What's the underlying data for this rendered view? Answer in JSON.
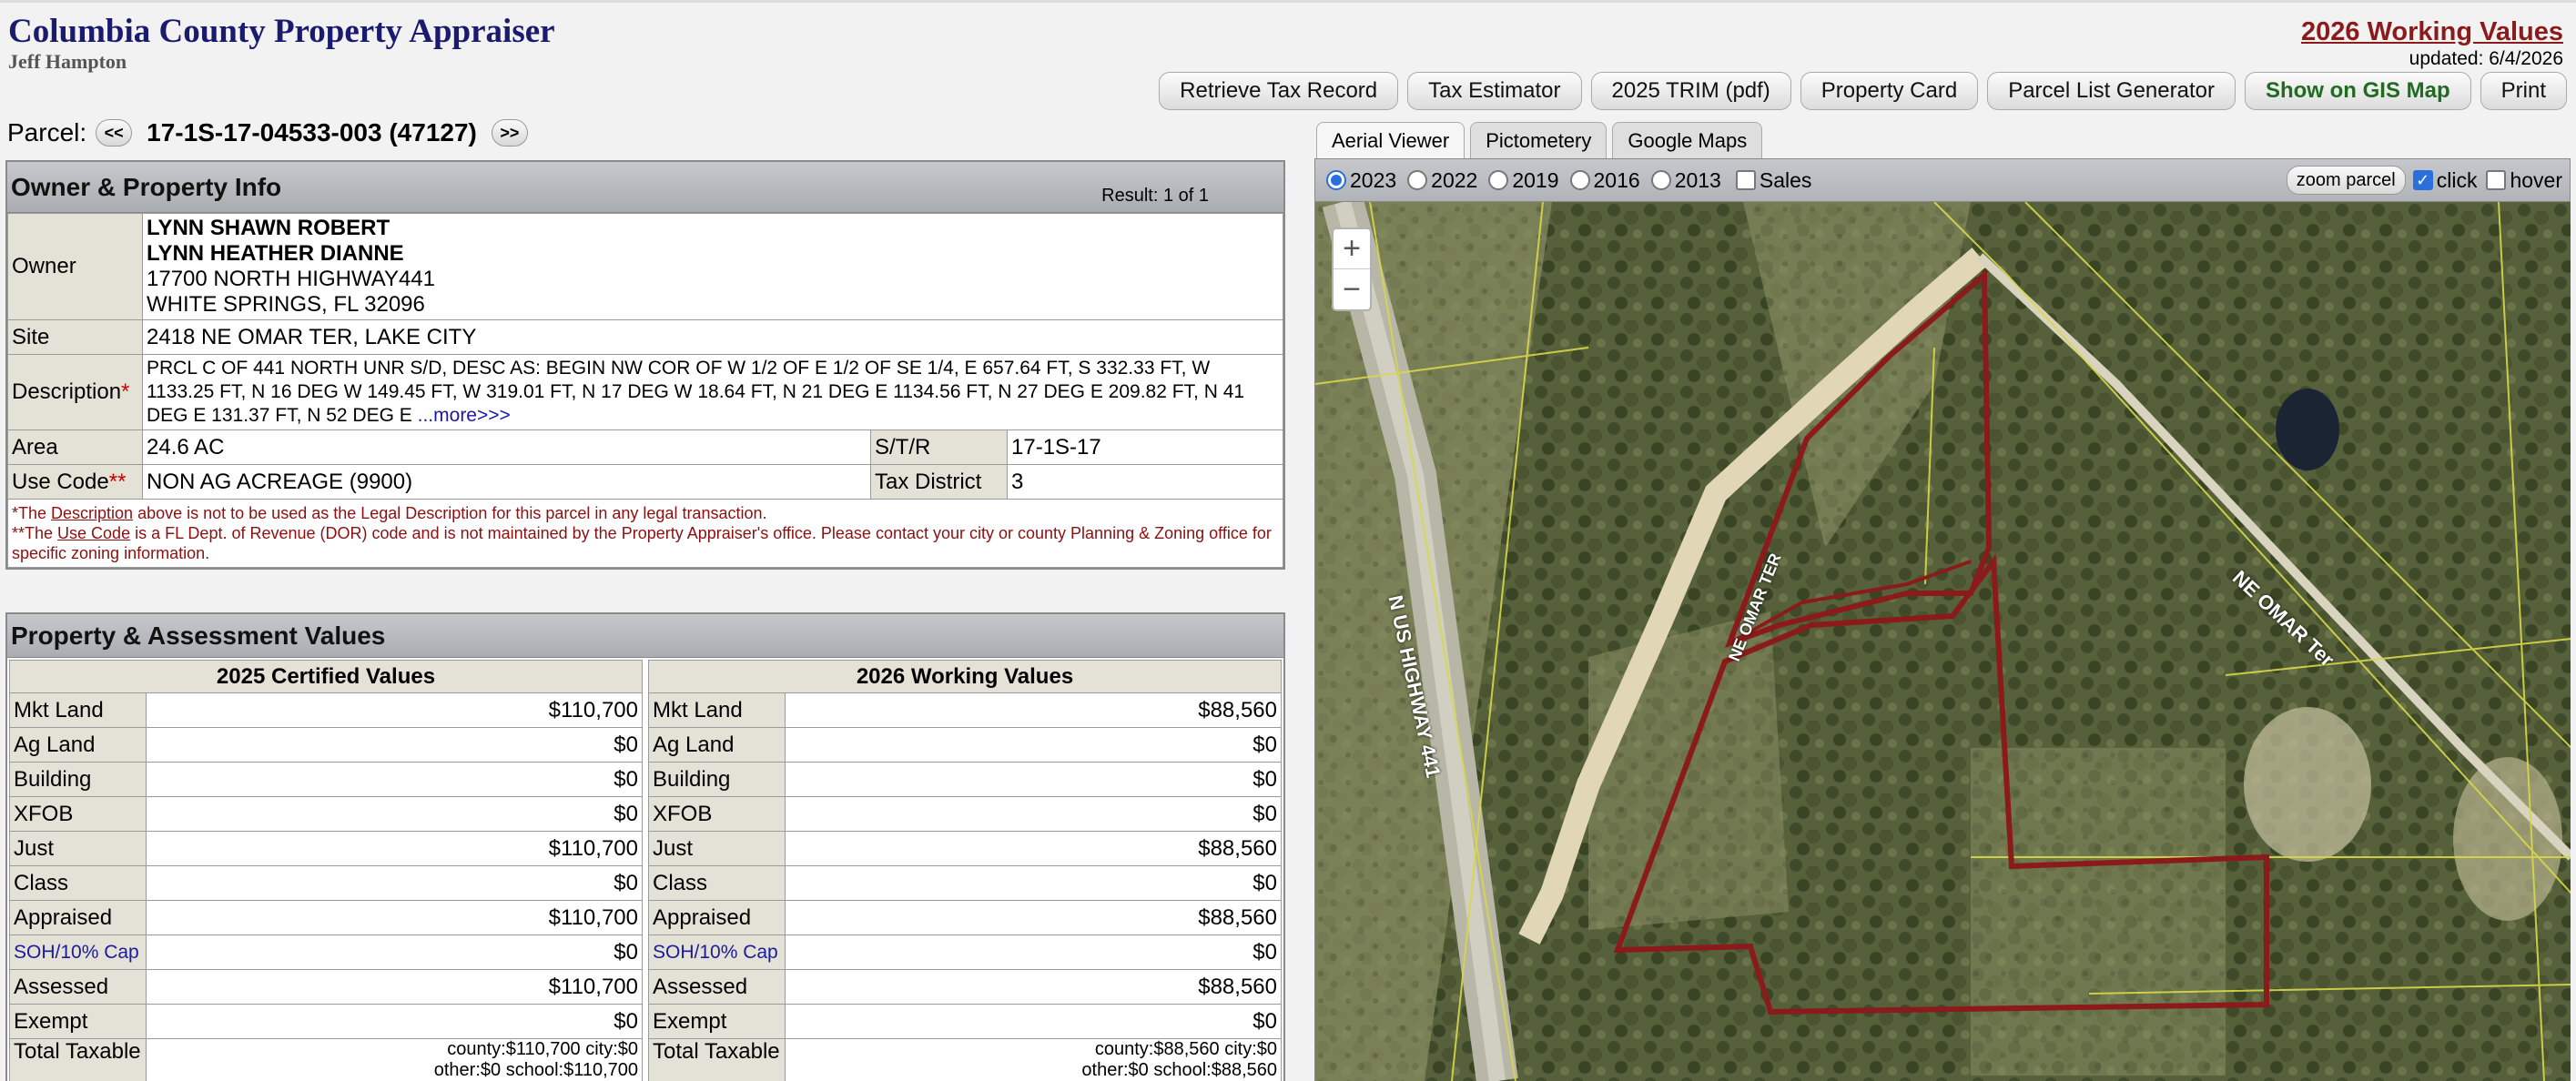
{
  "header": {
    "title": "Columbia County Property Appraiser",
    "subtitle": "Jeff Hampton",
    "working_values_link": "2026 Working Values",
    "updated": "updated: 6/4/2026"
  },
  "toolbar": {
    "retrieve": "Retrieve Tax Record",
    "estimator": "Tax Estimator",
    "trim": "2025 TRIM (pdf)",
    "card": "Property Card",
    "list": "Parcel List Generator",
    "gis": "Show on GIS Map",
    "print": "Print"
  },
  "parcel": {
    "label": "Parcel:",
    "prev": "<<",
    "id": "17-1S-17-04533-003 (47127)",
    "next": ">>"
  },
  "owner_panel": {
    "title": "Owner & Property Info",
    "result": "Result: 1 of 1",
    "owner_label": "Owner",
    "owner_lines": [
      "LYNN SHAWN ROBERT",
      "LYNN HEATHER DIANNE",
      "17700 NORTH HIGHWAY441",
      "WHITE SPRINGS, FL 32096"
    ],
    "site_label": "Site",
    "site": "2418 NE OMAR TER, LAKE CITY",
    "desc_label": "Description",
    "desc_mark": "*",
    "description": "PRCL C OF 441 NORTH UNR S/D, DESC AS: BEGIN NW COR OF W 1/2 OF E 1/2 OF SE 1/4, E 657.64 FT, S 332.33 FT, W 1133.25 FT, N 16 DEG W 149.45 FT, W 319.01 FT, N 17 DEG W 18.64 FT, N 21 DEG E 1134.56 FT, N 27 DEG E 209.82 FT, N 41 DEG E 131.37 FT, N 52 DEG E",
    "more": "...more>>>",
    "area_label": "Area",
    "area": "24.6 AC",
    "str_label": "S/T/R",
    "str": "17-1S-17",
    "use_label": "Use Code",
    "use_mark": "**",
    "use_code": "NON AG ACREAGE (9900)",
    "tax_label": "Tax District",
    "tax_district": "3",
    "note1_pre": "*The ",
    "note1_link": "Description",
    "note1_post": " above is not to be used as the Legal Description for this parcel in any legal transaction.",
    "note2_pre": "**The ",
    "note2_link": "Use Code",
    "note2_post": " is a FL Dept. of Revenue (DOR) code and is not maintained by the Property Appraiser's office. Please contact your city or county Planning & Zoning office for specific zoning information."
  },
  "values_panel": {
    "title": "Property & Assessment Values",
    "certified_header": "2025 Certified Values",
    "working_header": "2026 Working Values",
    "certified_rows": [
      {
        "label": "Mkt Land",
        "value": "$110,700"
      },
      {
        "label": "Ag Land",
        "value": "$0"
      },
      {
        "label": "Building",
        "value": "$0"
      },
      {
        "label": "XFOB",
        "value": "$0"
      },
      {
        "label": "Just",
        "value": "$110,700"
      },
      {
        "label": "Class",
        "value": "$0"
      },
      {
        "label": "Appraised",
        "value": "$110,700"
      },
      {
        "label": "SOH/10% Cap",
        "value": "$0"
      },
      {
        "label": "Assessed",
        "value": "$110,700"
      },
      {
        "label": "Exempt",
        "value": "$0"
      }
    ],
    "working_rows": [
      {
        "label": "Mkt Land",
        "value": "$88,560"
      },
      {
        "label": "Ag Land",
        "value": "$0"
      },
      {
        "label": "Building",
        "value": "$0"
      },
      {
        "label": "XFOB",
        "value": "$0"
      },
      {
        "label": "Just",
        "value": "$88,560"
      },
      {
        "label": "Class",
        "value": "$0"
      },
      {
        "label": "Appraised",
        "value": "$88,560"
      },
      {
        "label": "SOH/10% Cap",
        "value": "$0"
      },
      {
        "label": "Assessed",
        "value": "$88,560"
      },
      {
        "label": "Exempt",
        "value": "$0"
      }
    ],
    "total_label": "Total Taxable",
    "certified_total_line1": "county:$110,700 city:$0",
    "certified_total_line2": "other:$0 school:$110,700",
    "working_total_line1": "county:$88,560 city:$0",
    "working_total_line2": "other:$0 school:$88,560"
  },
  "map": {
    "tabs": [
      "Aerial Viewer",
      "Pictometery",
      "Google Maps"
    ],
    "years": [
      "2023",
      "2022",
      "2019",
      "2016",
      "2013"
    ],
    "selected_year": "2023",
    "sales_label": "Sales",
    "zoom_parcel": "zoom parcel",
    "click_label": "click",
    "hover_label": "hover",
    "zoom_in": "+",
    "zoom_out": "−",
    "road_labels": [
      "N US HIGHWAY 441",
      "NE OMAR Ter",
      "NE OMAR TER"
    ],
    "parcel_outline_color": "#8b1a1a",
    "parcel_line_color": "#d8d84a"
  }
}
